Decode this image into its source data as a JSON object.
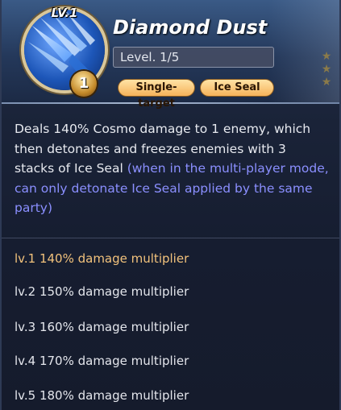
{
  "skill": {
    "level_badge": "LV.1",
    "rank": "1",
    "title": "Diamond Dust",
    "level_text": "Level. 1/5",
    "tags": [
      "Single-target",
      "Ice Seal"
    ]
  },
  "description": {
    "main": "Deals 140% Cosmo damage to 1 enemy, which then detonates and freezes enemies with 3 stacks of Ice Seal ",
    "note": "(when in the multi-player mode, can only detonate Ice Seal applied by the same party)"
  },
  "levels": [
    "lv.1 140% damage multiplier",
    "lv.2 150% damage multiplier",
    "lv.3 160% damage multiplier",
    "lv.4 170% damage multiplier",
    "lv.5 180% damage multiplier"
  ],
  "current_level": 1,
  "colors": {
    "active_level": "#f2c27c",
    "note_text": "#8b8fff",
    "tag_fill": "#f5b25a"
  },
  "icons": {
    "skill_icon": "ice-crystal-icon",
    "rank_badge": "rank-badge-icon"
  }
}
